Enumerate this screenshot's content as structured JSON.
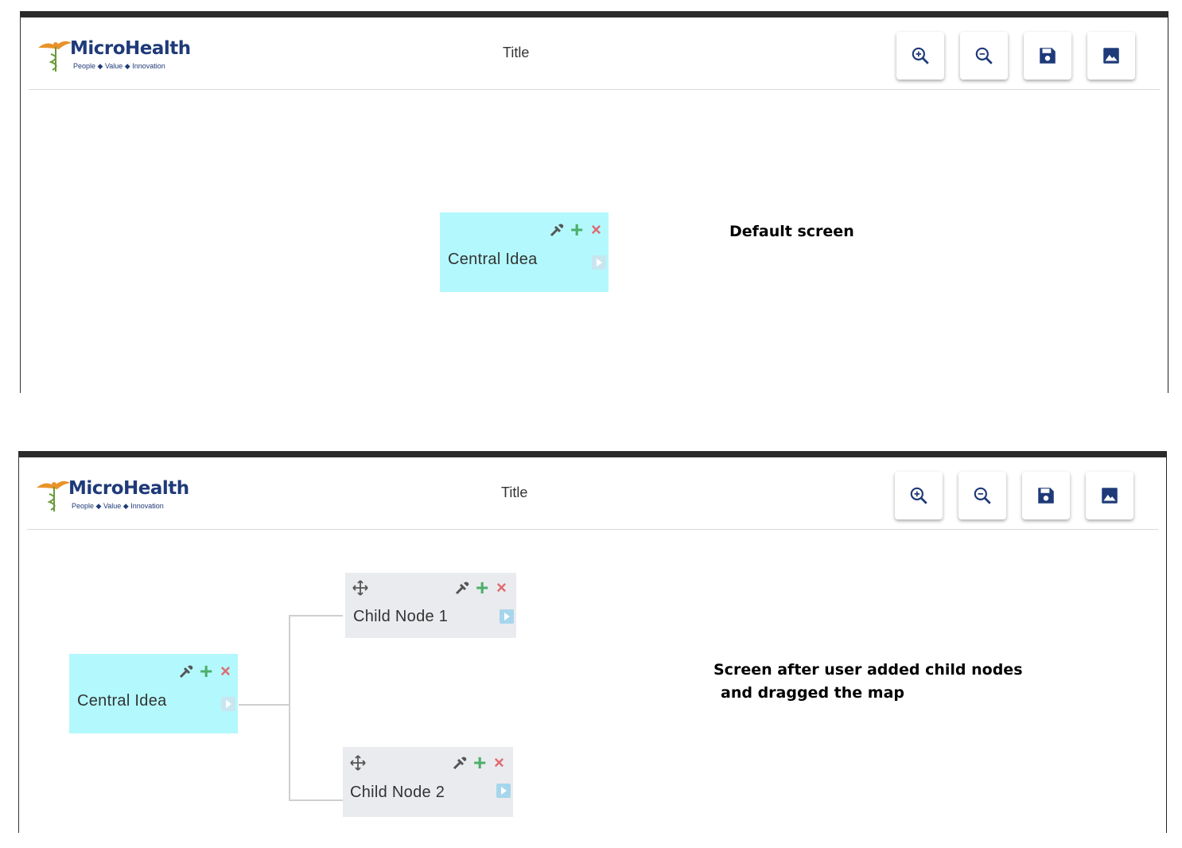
{
  "logo": {
    "name": "MicroHealth",
    "tagline": "People ◆ Value ◆ Innovation"
  },
  "screen_default": {
    "title": "Title",
    "central": {
      "label": "Central Idea"
    },
    "caption": "Default screen"
  },
  "screen_after": {
    "title": "Title",
    "central": {
      "label": "Central Idea"
    },
    "children": [
      {
        "label": "Child Node 1"
      },
      {
        "label": "Child Node 2"
      }
    ],
    "caption_line1": "Screen after user added child nodes",
    "caption_line2": "and dragged the map"
  },
  "toolbar": {
    "zoom_in_icon": "zoom-in-icon",
    "zoom_out_icon": "zoom-out-icon",
    "save_icon": "save-icon",
    "image_icon": "image-icon"
  },
  "node_actions": {
    "color_picker": "eyedropper-icon",
    "add": "+",
    "delete": "×",
    "expand": "expand-icon",
    "move": "move-icon"
  },
  "colors": {
    "central_bg": "#b3f8fc",
    "child_bg": "#eaebee",
    "add": "#4caf6b",
    "delete": "#e06a72",
    "toolbar_icon": "#1f3a78"
  }
}
